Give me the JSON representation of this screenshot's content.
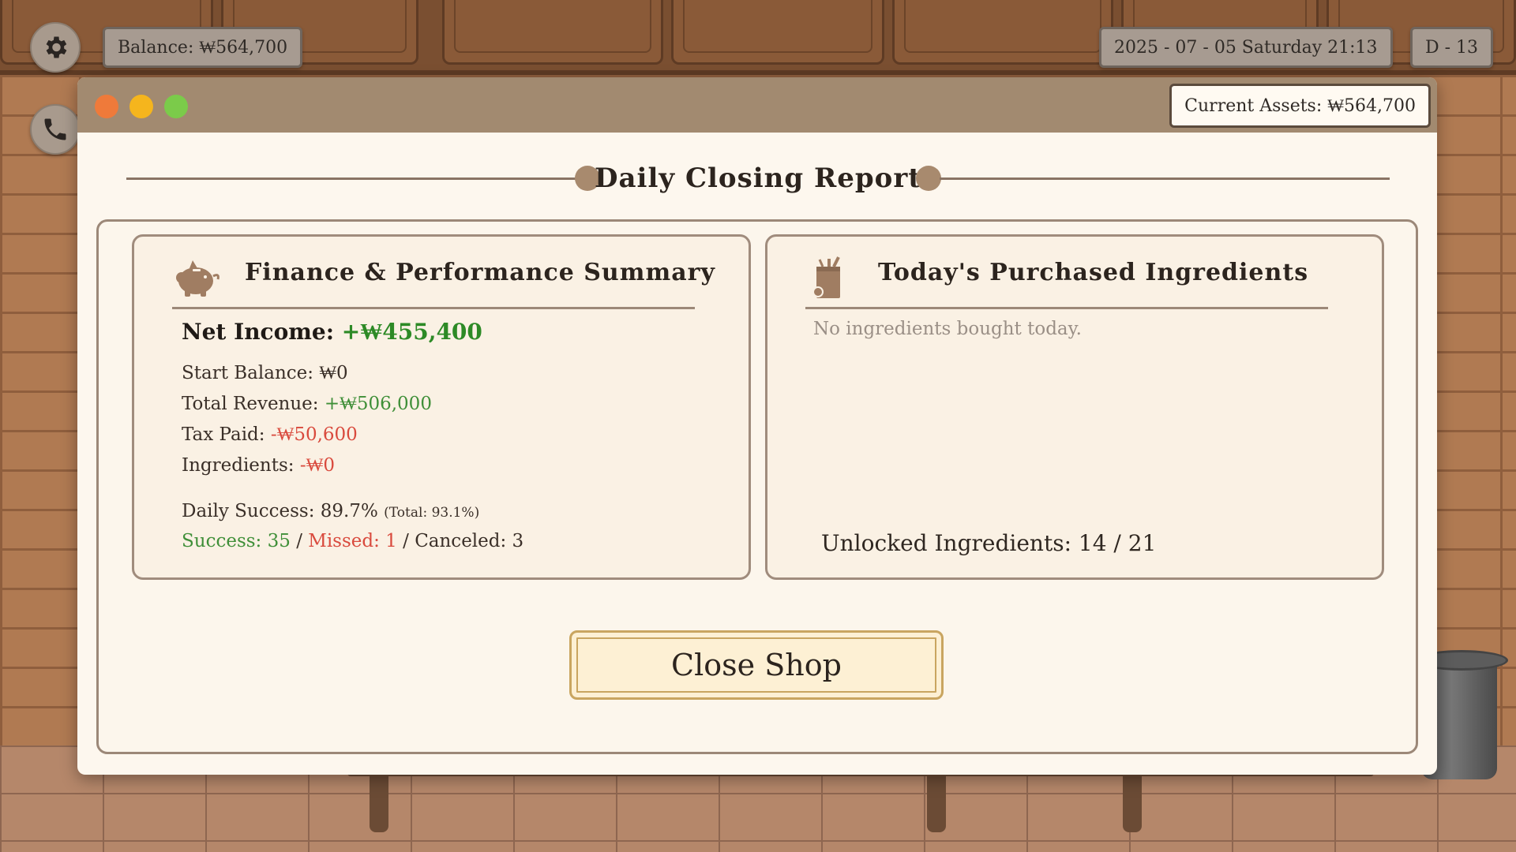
{
  "hud": {
    "balance": "Balance: ₩564,700",
    "datetime": "2025 - 07 - 05 Saturday 21:13",
    "day": "D - 13",
    "settings_icon": "gear-icon",
    "phone_icon": "phone-icon"
  },
  "window": {
    "current_assets": "Current Assets: ₩564,700",
    "traffic_colors": [
      "#ef7a3a",
      "#f5b51d",
      "#7bcb4a"
    ]
  },
  "report": {
    "title": "Daily Closing Report"
  },
  "finance": {
    "title": "Finance & Performance Summary",
    "icon": "piggy-bank-icon",
    "net_income_label": "Net Income: ",
    "net_income_value": "+₩455,400",
    "start_balance_label": "Start Balance: ",
    "start_balance_value": "₩0",
    "total_revenue_label": "Total Revenue: ",
    "total_revenue_value": "+₩506,000",
    "tax_paid_label": "Tax Paid: ",
    "tax_paid_value": "-₩50,600",
    "ingredients_label": "Ingredients: ",
    "ingredients_value": "-₩0",
    "daily_success_label": "Daily Success: 89.7% ",
    "daily_success_total": "(Total: 93.1%)",
    "success": "Success: 35",
    "sep1": " / ",
    "missed": "Missed: 1",
    "sep2": " / ",
    "canceled": "Canceled: 3"
  },
  "ingredients": {
    "title": "Today's Purchased Ingredients",
    "icon": "grocery-bag-icon",
    "empty_message": "No ingredients bought today.",
    "unlocked": "Unlocked Ingredients: 14 / 21"
  },
  "actions": {
    "close_shop": "Close Shop"
  },
  "colors": {
    "positive": "#2d8a26",
    "negative": "#d94a3d",
    "accent_gold": "#c9a560"
  }
}
